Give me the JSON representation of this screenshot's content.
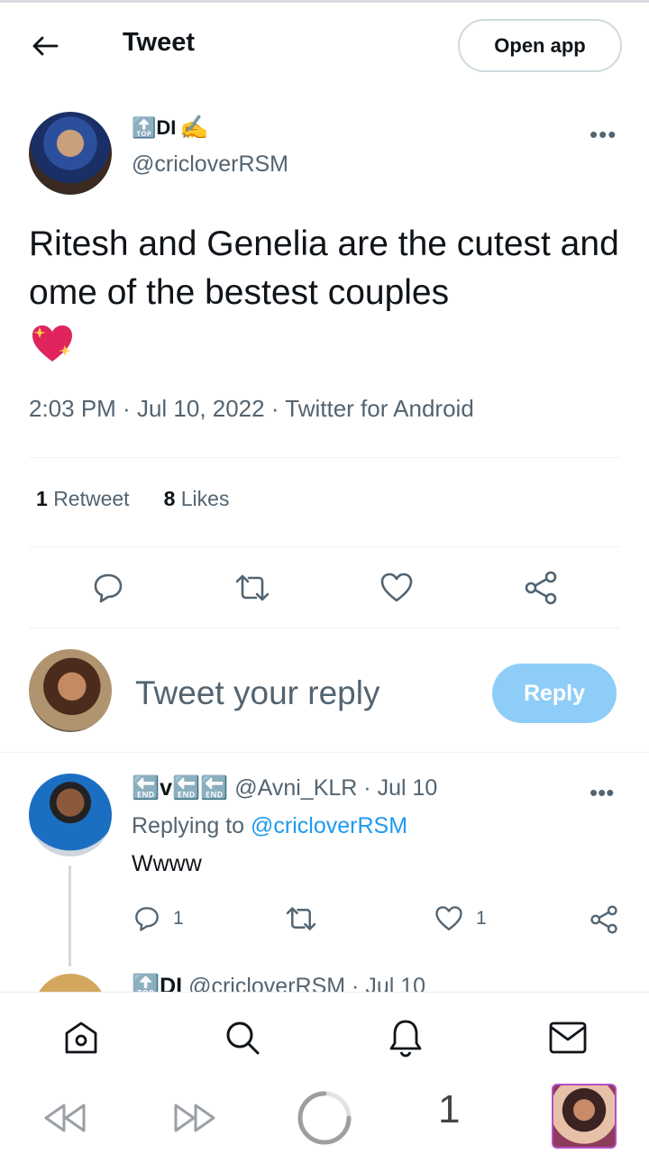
{
  "header": {
    "title": "Tweet",
    "open_app_label": "Open app"
  },
  "tweet": {
    "author_name": "🔝DI",
    "author_emoji": "✍️",
    "author_handle": "@cricloverRSM",
    "text": "Ritesh and Genelia are the cutest and  ome of the bestest couples",
    "time": "2:03 PM",
    "date": "Jul 10, 2022",
    "source": "Twitter for Android",
    "retweets": "1",
    "retweets_label": "Retweet",
    "likes": "8",
    "likes_label": "Likes"
  },
  "reply_box": {
    "placeholder": "Tweet your reply",
    "button_label": "Reply"
  },
  "comment": {
    "name": "🔚v🔚🔚",
    "handle": "@Avni_KLR",
    "date": "Jul 10",
    "replying_prefix": "Replying to",
    "replying_to": "@cricloverRSM",
    "text": "Wwww",
    "reply_count": "1",
    "like_count": "1"
  },
  "next_comment": {
    "name": "🔝DI",
    "handle": "@cricloverRSM",
    "date": "Jul 10"
  },
  "browser": {
    "tab_count": "1"
  },
  "colors": {
    "accent": "#1d9bf0",
    "reply_button": "#8ecdf8",
    "secondary_text": "#536471"
  },
  "icons": [
    "back-arrow-icon",
    "more-icon",
    "reply-icon",
    "retweet-icon",
    "like-icon",
    "share-icon",
    "home-icon",
    "search-icon",
    "notifications-icon",
    "messages-icon",
    "rewind-icon",
    "forward-icon",
    "loading-icon"
  ]
}
